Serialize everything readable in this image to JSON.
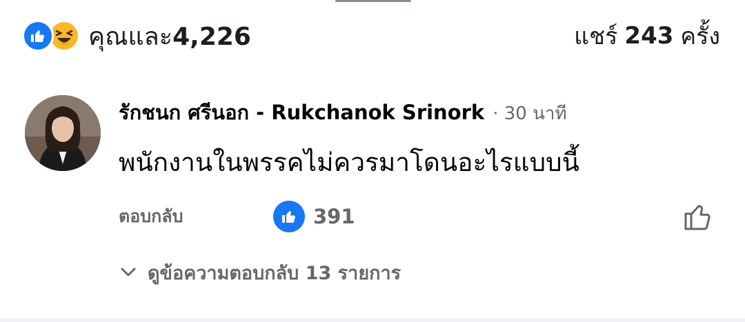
{
  "reactions": {
    "prefix": "คุณและ",
    "count": "4,226",
    "icons": [
      "like-icon",
      "haha-icon"
    ]
  },
  "shares": {
    "label": "แชร์",
    "count": "243",
    "suffix": "ครั้ง"
  },
  "comment": {
    "author": "รักชนก ศรีนอก - Rukchanok Srinork",
    "time": "· 30 นาที",
    "text": "พนักงานในพรรคไม่ควรมาโดนอะไรแบบนี้",
    "reply_label": "ตอบกลับ",
    "like_count": "391",
    "view_replies": "ดูข้อความตอบกลับ 13 รายการ"
  },
  "colors": {
    "like_blue": "#1877f2",
    "haha_yellow": "#f7b928",
    "secondary_text": "#65676b"
  }
}
